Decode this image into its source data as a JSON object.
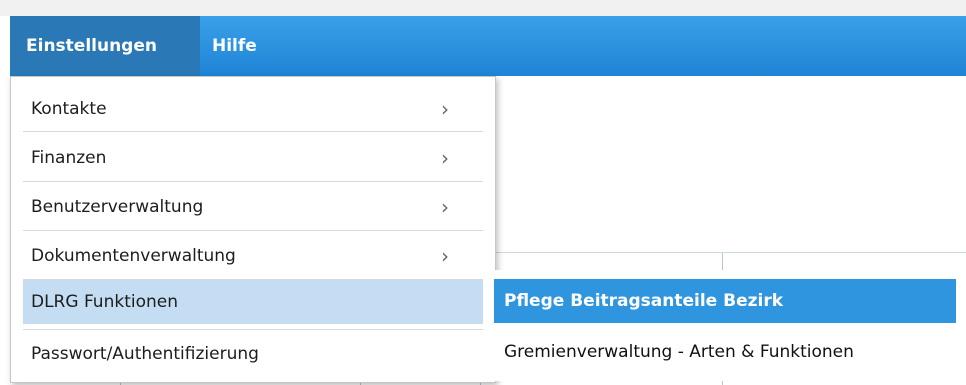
{
  "menubar": {
    "items": [
      {
        "label": "Einstellungen",
        "active": true
      },
      {
        "label": "Hilfe",
        "active": false
      }
    ]
  },
  "dropdown": {
    "items": [
      {
        "label": "Kontakte",
        "has_submenu": true
      },
      {
        "label": "Finanzen",
        "has_submenu": true
      },
      {
        "label": "Benutzerverwaltung",
        "has_submenu": true
      },
      {
        "label": "Dokumentenverwaltung",
        "has_submenu": true
      },
      {
        "label": "DLRG Funktionen",
        "has_submenu": false,
        "highlighted": true
      },
      {
        "label": "Passwort/Authentifizierung",
        "has_submenu": false
      }
    ],
    "arrow_glyph": "›"
  },
  "submenu": {
    "items": [
      {
        "label": "Pflege Beitragsanteile Bezirk",
        "selected": true
      },
      {
        "label": "Gremienverwaltung - Arten & Funktionen",
        "selected": false
      }
    ]
  },
  "colors": {
    "menubar": "#1f84d6",
    "menubar_active": "#2a78b5",
    "highlight": "#c4ddf2",
    "selected": "#2f95de"
  }
}
